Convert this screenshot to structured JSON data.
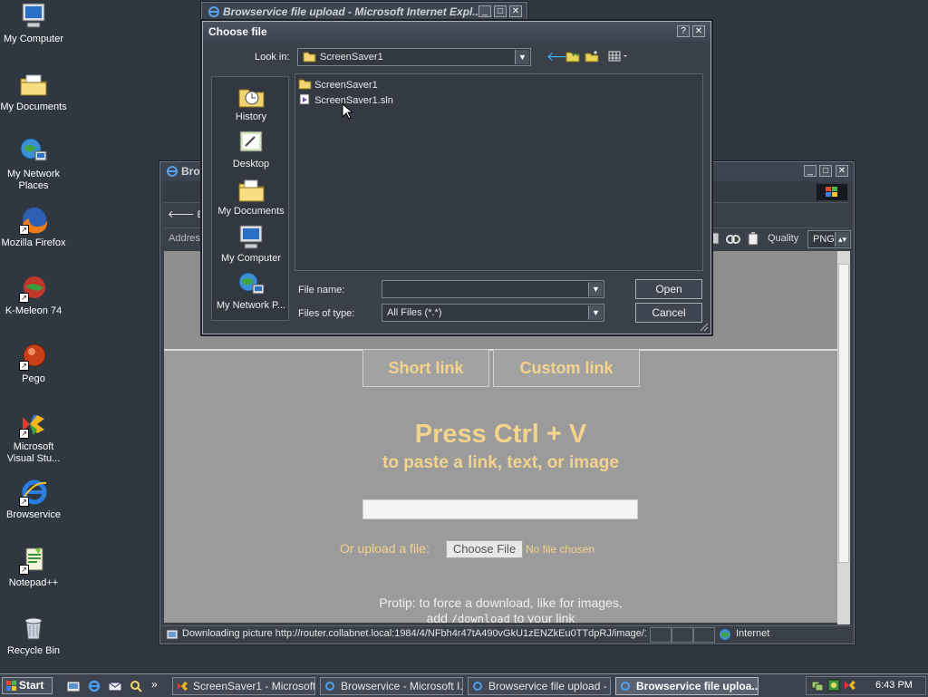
{
  "desktop": {
    "icons": [
      {
        "label": "My Computer",
        "icon": "my-computer-icon"
      },
      {
        "label": "My Documents",
        "icon": "my-documents-icon"
      },
      {
        "label": "My Network Places",
        "icon": "network-places-icon"
      },
      {
        "label": "Mozilla Firefox",
        "icon": "firefox-icon"
      },
      {
        "label": "K-Meleon 74",
        "icon": "kmeleon-icon"
      },
      {
        "label": "Pego",
        "icon": "pego-icon"
      },
      {
        "label": "Microsoft Visual Stu...",
        "icon": "visual-studio-icon"
      },
      {
        "label": "Browservice",
        "icon": "internet-explorer-icon"
      },
      {
        "label": "Notepad++",
        "icon": "notepadpp-icon"
      },
      {
        "label": "Recycle Bin",
        "icon": "recycle-bin-icon"
      }
    ]
  },
  "back_window": {
    "title": "Browservice file upload - Microsoft Internet Expl..."
  },
  "browser": {
    "title_fragment": "Brow",
    "back_label": "Back",
    "address_label": "Addres",
    "quality_label": "Quality",
    "quality_value": "PNG",
    "page": {
      "short_link": "Short link",
      "custom_link": "Custom link",
      "press_title": "Press Ctrl + V",
      "press_sub": "to paste a link, text, or image",
      "upload_label": "Or upload a file:",
      "choose_file": "Choose File",
      "no_file": "No file chosen",
      "protip_line1": "Protip: to force a download, like for images,",
      "protip_line2_pre": "add",
      "protip_code": "/download",
      "protip_line2_post": "to your link"
    },
    "status_text": "Downloading picture http://router.collabnet.local:1984/4/NFbh4r47tA490vGkU1zENZkEu0TTdpRJ/image/1/",
    "zone": "Internet"
  },
  "dialog": {
    "title": "Choose file",
    "help_btn": "?",
    "close_btn": "✕",
    "look_in_label": "Look in:",
    "look_in_value": "ScreenSaver1",
    "places": [
      "History",
      "Desktop",
      "My Documents",
      "My Computer",
      "My Network P..."
    ],
    "files": [
      {
        "name": "ScreenSaver1",
        "type": "folder"
      },
      {
        "name": "ScreenSaver1.sln",
        "type": "solution"
      }
    ],
    "file_name_label": "File name:",
    "file_name_value": "",
    "files_of_type_label": "Files of type:",
    "files_of_type_value": "All Files (*.*)",
    "open": "Open",
    "cancel": "Cancel"
  },
  "taskbar": {
    "start": "Start",
    "items": [
      {
        "label": "ScreenSaver1 - Microsoft ...",
        "active": false
      },
      {
        "label": "Browservice - Microsoft I...",
        "active": false
      },
      {
        "label": "Browservice file upload - ...",
        "active": false
      },
      {
        "label": "Browservice file uploa...",
        "active": true
      }
    ],
    "clock": "6:43 PM",
    "quicklaunch_more": "»"
  }
}
